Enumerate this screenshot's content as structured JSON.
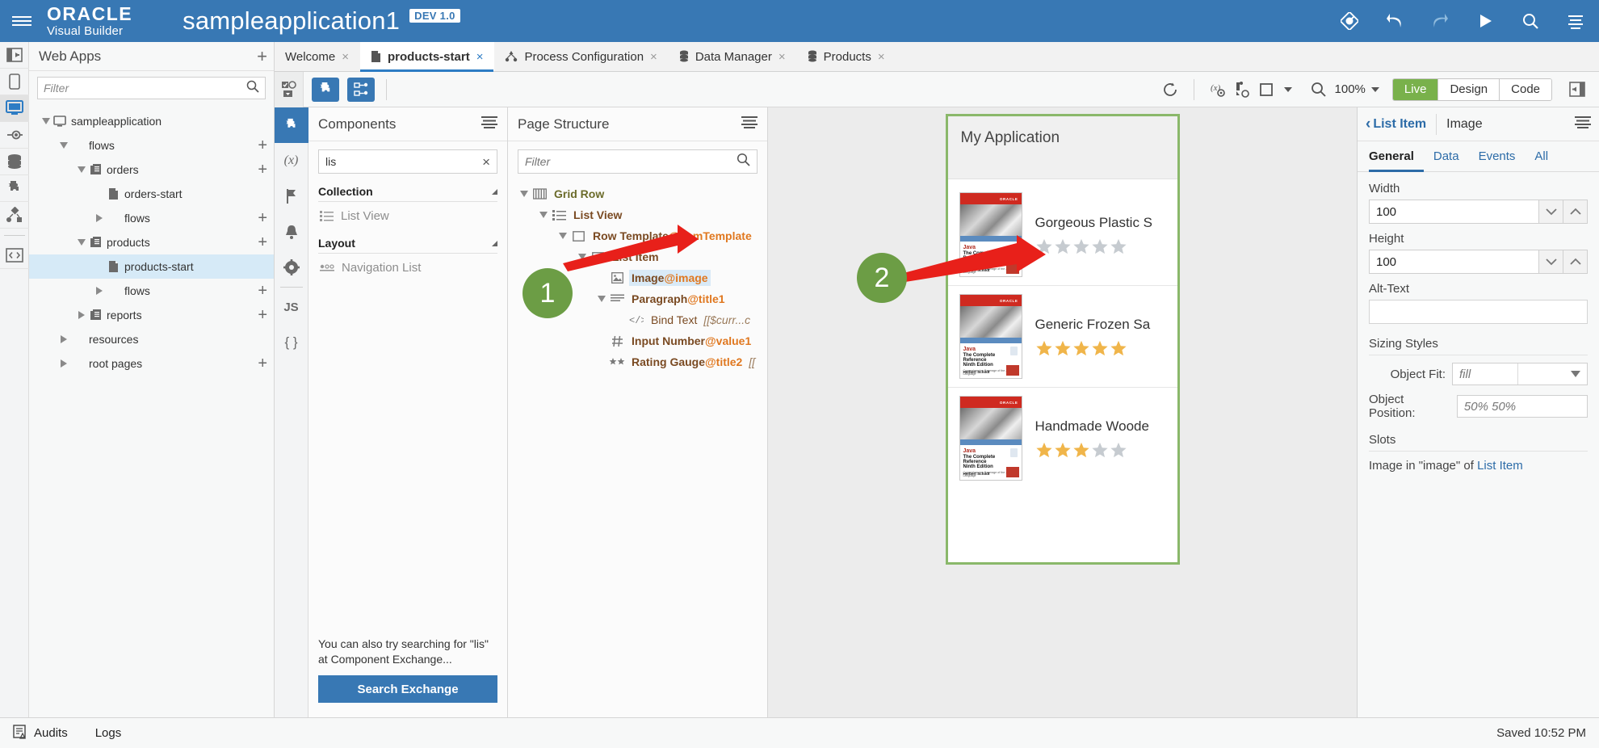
{
  "topbar": {
    "menu_icon": "hamburger-icon",
    "brand": "ORACLE",
    "brand_sub": "Visual Builder",
    "app_title": "sampleapplication1",
    "badge": "DEV 1.0",
    "icons": [
      "git-branch-icon",
      "undo-icon",
      "redo-icon",
      "run-icon",
      "search-icon",
      "menu-icon"
    ],
    "accent": "#3878b4"
  },
  "rail": {
    "items": [
      {
        "name": "collapse-panel-icon",
        "active": false
      },
      {
        "name": "mobile-apps-icon",
        "active": false
      },
      {
        "name": "web-apps-icon",
        "active": true
      },
      {
        "name": "service-connections-icon",
        "active": false
      },
      {
        "name": "business-objects-icon",
        "active": false
      },
      {
        "name": "components-icon",
        "active": false
      },
      {
        "name": "processes-icon",
        "active": false
      },
      {
        "name": "source-view-icon",
        "active": false
      }
    ]
  },
  "webapps": {
    "title": "Web Apps",
    "add_label": "+",
    "filter_placeholder": "Filter",
    "filter_value": "",
    "tree": [
      {
        "label": "sampleapplication",
        "indent": 0,
        "twisty": "down",
        "icon": "monitor-icon",
        "plus": false,
        "selected": false
      },
      {
        "label": "flows",
        "indent": 1,
        "twisty": "down",
        "icon": "",
        "plus": true,
        "selected": false
      },
      {
        "label": "orders",
        "indent": 2,
        "twisty": "down",
        "icon": "flow-icon",
        "plus": true,
        "selected": false
      },
      {
        "label": "orders-start",
        "indent": 3,
        "twisty": "none",
        "icon": "page-icon",
        "plus": false,
        "selected": false
      },
      {
        "label": "flows",
        "indent": 3,
        "twisty": "right",
        "icon": "",
        "plus": true,
        "selected": false
      },
      {
        "label": "products",
        "indent": 2,
        "twisty": "down",
        "icon": "flow-icon",
        "plus": true,
        "selected": false
      },
      {
        "label": "products-start",
        "indent": 3,
        "twisty": "none",
        "icon": "page-icon",
        "plus": false,
        "selected": true
      },
      {
        "label": "flows",
        "indent": 3,
        "twisty": "right",
        "icon": "",
        "plus": true,
        "selected": false
      },
      {
        "label": "reports",
        "indent": 2,
        "twisty": "right",
        "icon": "flow-icon",
        "plus": true,
        "selected": false
      },
      {
        "label": "resources",
        "indent": 1,
        "twisty": "right",
        "icon": "",
        "plus": false,
        "selected": false
      },
      {
        "label": "root pages",
        "indent": 1,
        "twisty": "right",
        "icon": "",
        "plus": true,
        "selected": false
      }
    ]
  },
  "tabs": [
    {
      "label": "Welcome",
      "icon": "",
      "active": false,
      "close": "×"
    },
    {
      "label": "products-start",
      "icon": "page-icon",
      "active": true,
      "close": "×"
    },
    {
      "label": "Process Configuration",
      "icon": "process-icon",
      "active": false,
      "close": "×"
    },
    {
      "label": "Data Manager",
      "icon": "data-icon",
      "active": false,
      "close": "×"
    },
    {
      "label": "Products",
      "icon": "data-icon",
      "active": false,
      "close": "×"
    }
  ],
  "toolbar": {
    "select_icon": "selection-dropdown-icon",
    "left_buttons": [
      {
        "name": "components-palette-button",
        "icon": "puzzle-icon",
        "active": true
      },
      {
        "name": "page-structure-button",
        "icon": "structure-icon",
        "active": true
      }
    ],
    "right_icons": [
      {
        "name": "refresh-button",
        "icon": "refresh-icon"
      },
      {
        "name": "variables-button",
        "icon": "variables-icon"
      },
      {
        "name": "actions-button",
        "icon": "actions-icon"
      },
      {
        "name": "device-preview-button",
        "icon": "device-icon"
      }
    ],
    "zoom_icon": "magnifier-icon",
    "zoom_value": "100%",
    "modes": [
      {
        "label": "Live",
        "active": true
      },
      {
        "label": "Design",
        "active": false
      },
      {
        "label": "Code",
        "active": false
      }
    ],
    "expand_right_icon": "expand-right-panel-icon"
  },
  "crail": {
    "items": [
      {
        "name": "components-tab-icon",
        "glyph": "",
        "active": true
      },
      {
        "name": "variables-tab-icon",
        "glyph": "(x)",
        "active": false
      },
      {
        "name": "flags-tab-icon",
        "glyph": "",
        "active": false
      },
      {
        "name": "events-tab-icon",
        "glyph": "",
        "active": false
      },
      {
        "name": "settings-tab-icon",
        "glyph": "",
        "active": false
      },
      {
        "name": "javascript-tab-icon",
        "glyph": "JS",
        "active": false
      },
      {
        "name": "json-tab-icon",
        "glyph": "{ }",
        "active": false
      }
    ]
  },
  "components": {
    "title": "Components",
    "menu_icon": "hamburger-icon",
    "search_value": "lis",
    "search_clear": "×",
    "groups": [
      {
        "title": "Collection",
        "items": [
          {
            "label": "List View",
            "icon": "list-view-icon"
          }
        ]
      },
      {
        "title": "Layout",
        "items": [
          {
            "label": "Navigation List",
            "icon": "navigation-list-icon"
          }
        ]
      }
    ],
    "footer_text": "You can also try searching for \"lis\" at Component Exchange...",
    "footer_button": "Search Exchange"
  },
  "page_structure": {
    "title": "Page Structure",
    "menu_icon": "hamburger-icon",
    "filter_placeholder": "Filter",
    "filter_value": "",
    "nodes": [
      {
        "label": "Grid Row",
        "at": "",
        "expr": "",
        "indent": 0,
        "twisty": "down",
        "icon": "grid-row-icon",
        "selected": false,
        "olive": true
      },
      {
        "label": "List View",
        "at": "",
        "expr": "",
        "indent": 1,
        "twisty": "down",
        "icon": "list-view-icon",
        "selected": false,
        "olive": false
      },
      {
        "label": "Row Template",
        "at": "@itemTemplate",
        "expr": "",
        "indent": 2,
        "twisty": "down",
        "icon": "box-icon",
        "selected": false,
        "olive": false
      },
      {
        "label": "List Item",
        "at": "",
        "expr": "",
        "indent": 3,
        "twisty": "down",
        "icon": "box-icon",
        "selected": false,
        "olive": false
      },
      {
        "label": "Image",
        "at": "@image",
        "expr": "",
        "indent": 4,
        "twisty": "none",
        "icon": "image-icon",
        "selected": true,
        "olive": false
      },
      {
        "label": "Paragraph",
        "at": "@title1",
        "expr": "",
        "indent": 4,
        "twisty": "down",
        "icon": "paragraph-icon",
        "selected": false,
        "olive": false
      },
      {
        "label": "Bind Text",
        "at": "",
        "expr": "[[$curr...c",
        "indent": 5,
        "twisty": "none",
        "icon": "code-icon",
        "selected": false,
        "olive": false
      },
      {
        "label": "Input Number",
        "at": "@value1",
        "expr": "",
        "indent": 4,
        "twisty": "none",
        "icon": "hash-icon",
        "selected": false,
        "olive": false
      },
      {
        "label": "Rating Gauge",
        "at": "@title2",
        "expr": "[[",
        "indent": 4,
        "twisty": "none",
        "icon": "stars-icon",
        "selected": false,
        "olive": false
      }
    ]
  },
  "preview": {
    "app_title": "My Application",
    "border_color": "#8ab86a",
    "items": [
      {
        "name": "Gorgeous Plastic S",
        "rating": 0,
        "max": 5
      },
      {
        "name": "Generic Frozen Sa",
        "rating": 5,
        "max": 5
      },
      {
        "name": "Handmade Woode",
        "rating": 3,
        "max": 5
      }
    ],
    "book": {
      "publisher": "ORACLE",
      "title_accent": "Java",
      "line1": "The Complete Reference",
      "line2": "Ninth Edition",
      "line3": "Comprehensive Coverage of the Java Language",
      "author": "Herbert Schildt"
    },
    "star_on_color": "#f0b54a",
    "star_off_color": "#c6cbd0"
  },
  "properties": {
    "back_label": "List Item",
    "back_chevron": "‹",
    "current": "Image",
    "menu_icon": "hamburger-icon",
    "tabs": [
      {
        "label": "General",
        "active": true
      },
      {
        "label": "Data",
        "active": false
      },
      {
        "label": "Events",
        "active": false
      },
      {
        "label": "All",
        "active": false
      }
    ],
    "width_label": "Width",
    "width_value": "100",
    "height_label": "Height",
    "height_value": "100",
    "alt_label": "Alt-Text",
    "alt_value": "",
    "sizing_title": "Sizing Styles",
    "object_fit_label": "Object Fit:",
    "object_fit_value": "fill",
    "object_position_label": "Object Position:",
    "object_position_value": "50% 50%",
    "slots_title": "Slots",
    "slot_prefix": "Image in \"image\" of ",
    "slot_link": "List Item"
  },
  "status": {
    "audits_icon": "audits-icon",
    "audits": "Audits",
    "logs": "Logs",
    "saved": "Saved 10:52 PM"
  },
  "callouts": [
    {
      "number": "1"
    },
    {
      "number": "2"
    }
  ]
}
